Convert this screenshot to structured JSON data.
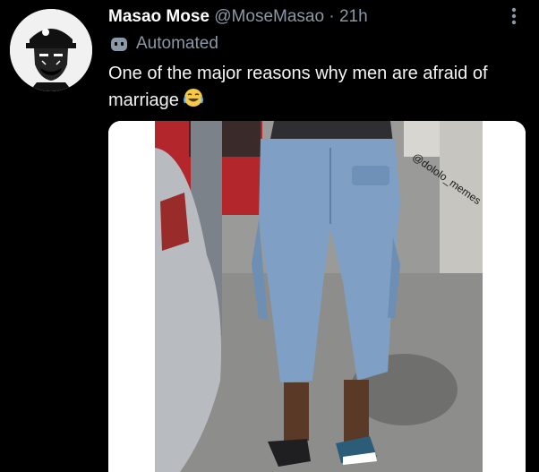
{
  "author": {
    "display_name": "Masao Mose",
    "handle": "@MoseMasao",
    "separator": "·",
    "time": "21h",
    "label": "Automated"
  },
  "tweet": {
    "text": "One of the major reasons why men  are afraid of marriage",
    "emoji_icon": "face-with-tears-of-joy-icon"
  },
  "media": {
    "watermark": "@dololo_memes"
  },
  "colors": {
    "background": "#000000",
    "primary_text": "#e7e9ea",
    "secondary_text": "#8b98a5",
    "jeans": "#7fa0c4"
  }
}
